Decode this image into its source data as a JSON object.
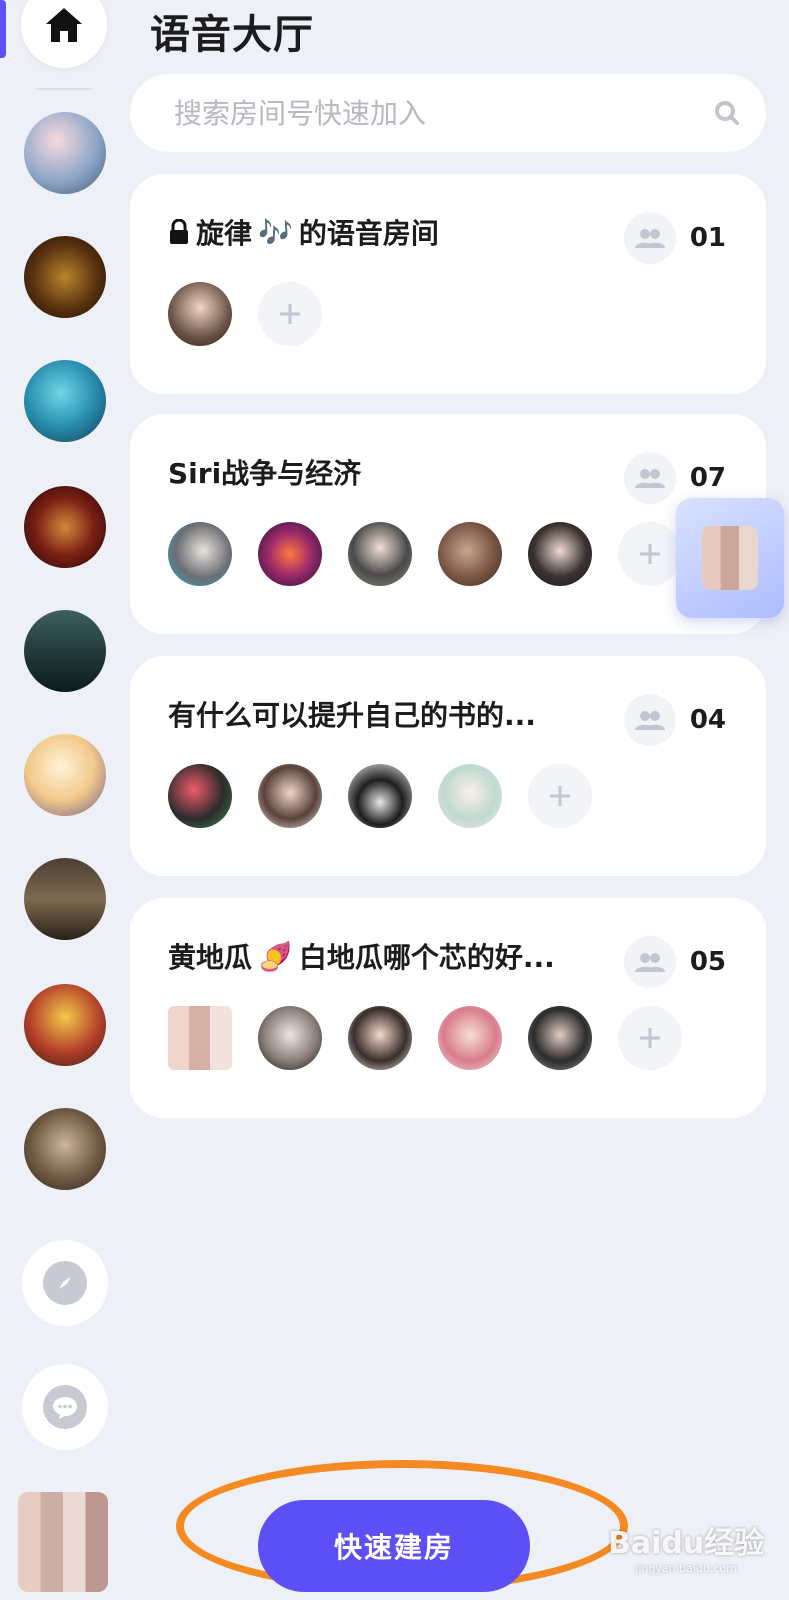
{
  "header": {
    "title": "语音大厅"
  },
  "search": {
    "placeholder": "搜索房间号快速加入"
  },
  "rooms": [
    {
      "locked": true,
      "title_prefix": "旋律",
      "title_emoji": "🎶",
      "title_suffix": "的语音房间",
      "count": "01"
    },
    {
      "title": "Siri战争与经济",
      "count": "07"
    },
    {
      "title": "有什么可以提升自己的书的...",
      "count": "04"
    },
    {
      "title_prefix": "黄地瓜",
      "title_emoji": "🍠",
      "title_suffix": "白地瓜哪个芯的好...",
      "count": "05"
    }
  ],
  "actions": {
    "create_room": "快速建房"
  },
  "watermark": {
    "line1": "Baidu经验",
    "line2": "jingyan.baidu.com"
  },
  "colors": {
    "accent": "#5b4ff5",
    "highlight": "#f58a22",
    "background": "#eef0f7"
  },
  "sidebar": {
    "icons": [
      "home-icon",
      "compass-icon",
      "chat-icon"
    ]
  }
}
